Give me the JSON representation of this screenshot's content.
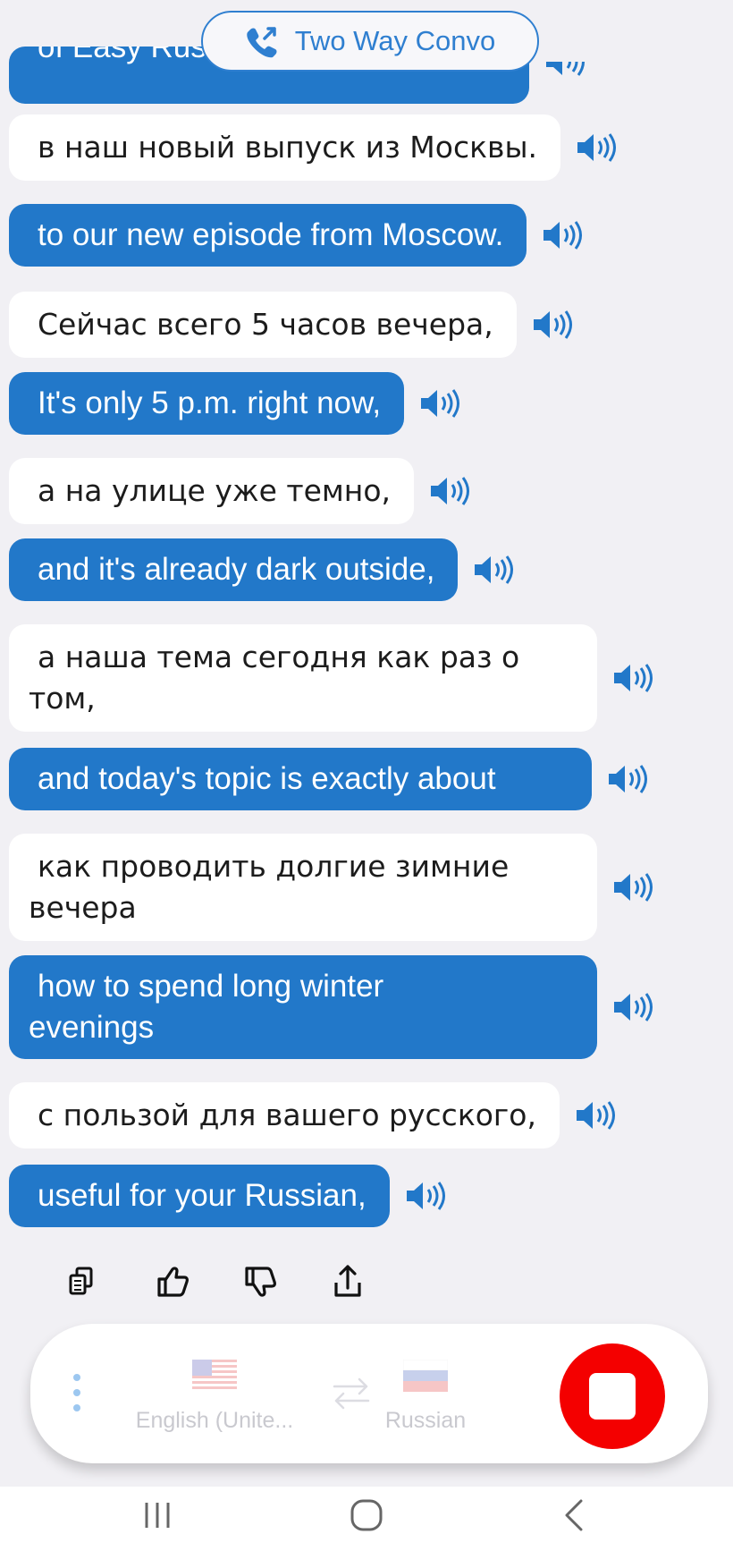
{
  "header": {
    "mode_label": "Two Way Convo"
  },
  "messages": [
    {
      "text": "of Easy Russian, and welcome",
      "kind": "translation",
      "partial": true
    },
    {
      "text": "в наш новый выпуск из Москвы.",
      "kind": "source"
    },
    {
      "text": "to our new episode from Moscow.",
      "kind": "translation"
    },
    {
      "text": "Сейчас всего 5 часов вечера,",
      "kind": "source"
    },
    {
      "text": "It's only 5 p.m. right now,",
      "kind": "translation"
    },
    {
      "text": "а на улице уже темно,",
      "kind": "source"
    },
    {
      "text": "and it's already dark outside,",
      "kind": "translation"
    },
    {
      "line1": "а наша тема сегодня как раз о",
      "line2": "том,",
      "kind": "source"
    },
    {
      "text": "and today's topic is exactly about",
      "kind": "translation"
    },
    {
      "line1": "как проводить долгие зимние",
      "line2": "вечера",
      "kind": "source"
    },
    {
      "line1": "how to spend long winter",
      "line2": "evenings",
      "kind": "translation"
    },
    {
      "text": "с пользой для вашего русского,",
      "kind": "source"
    },
    {
      "text": "useful for your Russian,",
      "kind": "translation"
    }
  ],
  "actions": [
    "copy-icon",
    "thumbs-up-icon",
    "thumbs-down-icon",
    "share-icon"
  ],
  "controls": {
    "left_language": "English (Unite...",
    "right_language": "Russian",
    "left_flag": "us-flag-icon",
    "right_flag": "russia-flag-icon",
    "stop": "stop-icon"
  },
  "colors": {
    "accent": "#2278c9",
    "stop": "#f40000",
    "background": "#f1f0f4"
  },
  "navbar": [
    "recent-apps-icon",
    "home-icon",
    "back-icon"
  ]
}
